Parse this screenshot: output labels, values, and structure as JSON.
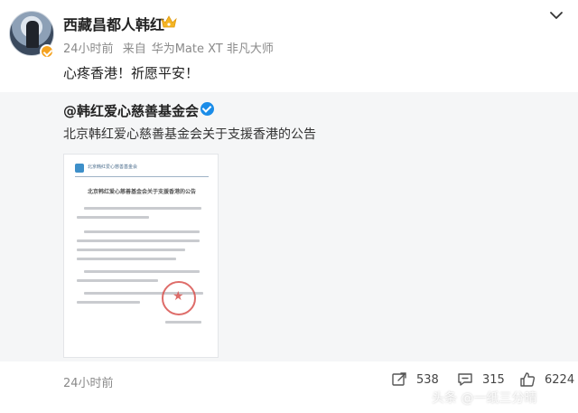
{
  "post": {
    "author": "西藏昌都人韩红",
    "time": "24小时前",
    "source_prefix": "来自",
    "device": "华为Mate XT 非凡大师",
    "content": "心疼香港！祈愿平安！",
    "icons": {
      "vip": "crown-icon",
      "verified": "verified-badge-icon",
      "more": "chevron-down-icon"
    }
  },
  "repost": {
    "author": "@韩红爱心慈善基金会",
    "text": "北京韩红爱心慈善基金会关于支援香港的公告",
    "doc": {
      "header": "北京韩红爱心慈善基金会",
      "title": "北京韩红爱心慈善基金会关于支援香港的公告"
    }
  },
  "footer": {
    "time": "24小时前",
    "reposts": "538",
    "comments": "315",
    "likes": "6224"
  },
  "watermark": "头条 @一纸三分晴",
  "colors": {
    "brand_blue": "#1a8ce8",
    "badge_orange": "#f4a21f",
    "seal_red": "#d9534f",
    "muted": "#8a8a8a"
  }
}
